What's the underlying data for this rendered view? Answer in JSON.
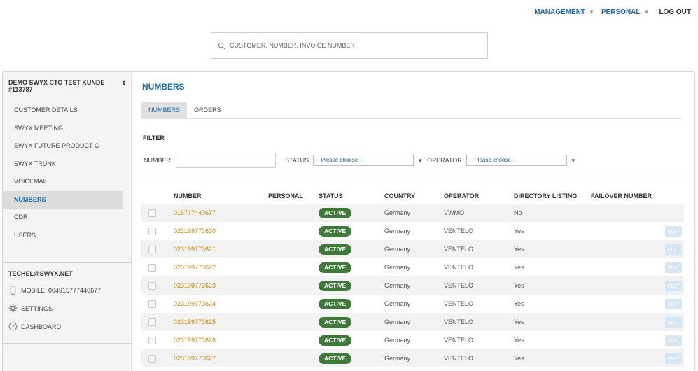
{
  "topnav": {
    "management": "MANAGEMENT",
    "personal": "PERSONAL",
    "logout": "LOG OUT"
  },
  "search": {
    "placeholder": "CUSTOMER, NUMBER, INVOICE NUMBER"
  },
  "sidebar": {
    "customer_title": "DEMO SWYX CTO TEST KUNDE #113787",
    "items": [
      {
        "label": "CUSTOMER DETAILS"
      },
      {
        "label": "SWYX MEETING"
      },
      {
        "label": "SWYX FUTURE PRODUCT C"
      },
      {
        "label": "SWYX TRUNK"
      },
      {
        "label": "VOICEMAIL"
      },
      {
        "label": "NUMBERS"
      },
      {
        "label": "CDR"
      },
      {
        "label": "USERS"
      }
    ],
    "active_item": "NUMBERS",
    "user_email": "TECHEL@SWYX.NET",
    "mobile": "MOBILE: 004915777440677",
    "settings": "SETTINGS",
    "dashboard": "DASHBOARD"
  },
  "main": {
    "title": "NUMBERS",
    "tabs": [
      {
        "label": "NUMBERS"
      },
      {
        "label": "ORDERS"
      }
    ],
    "filter": {
      "title": "FILTER",
      "number_label": "NUMBER",
      "status_label": "STATUS",
      "status_value": "-- Please choose --",
      "operator_label": "OPERATOR",
      "operator_value": "-- Please choose --"
    },
    "table": {
      "headers": [
        "NUMBER",
        "PERSONAL",
        "STATUS",
        "COUNTRY",
        "OPERATOR",
        "DIRECTORY LISTING",
        "FAILOVER NUMBER"
      ],
      "edit_label": "EDIT",
      "rows": [
        {
          "number": "015777440677",
          "personal": "",
          "status": "ACTIVE",
          "country": "Germany",
          "operator": "VWMO",
          "directory": "No",
          "failover": "",
          "edit": false
        },
        {
          "number": "023199773620",
          "personal": "",
          "status": "ACTIVE",
          "country": "Germany",
          "operator": "VENTELO",
          "directory": "Yes",
          "failover": "",
          "edit": true
        },
        {
          "number": "023199773621",
          "personal": "",
          "status": "ACTIVE",
          "country": "Germany",
          "operator": "VENTELO",
          "directory": "Yes",
          "failover": "",
          "edit": true
        },
        {
          "number": "023199773622",
          "personal": "",
          "status": "ACTIVE",
          "country": "Germany",
          "operator": "VENTELO",
          "directory": "Yes",
          "failover": "",
          "edit": true
        },
        {
          "number": "023199773623",
          "personal": "",
          "status": "ACTIVE",
          "country": "Germany",
          "operator": "VENTELO",
          "directory": "Yes",
          "failover": "",
          "edit": true
        },
        {
          "number": "023199773624",
          "personal": "",
          "status": "ACTIVE",
          "country": "Germany",
          "operator": "VENTELO",
          "directory": "Yes",
          "failover": "",
          "edit": true
        },
        {
          "number": "023199773625",
          "personal": "",
          "status": "ACTIVE",
          "country": "Germany",
          "operator": "VENTELO",
          "directory": "Yes",
          "failover": "",
          "edit": true
        },
        {
          "number": "023199773626",
          "personal": "",
          "status": "ACTIVE",
          "country": "Germany",
          "operator": "VENTELO",
          "directory": "Yes",
          "failover": "",
          "edit": true
        },
        {
          "number": "023199773627",
          "personal": "",
          "status": "ACTIVE",
          "country": "Germany",
          "operator": "VENTELO",
          "directory": "Yes",
          "failover": "",
          "edit": true
        }
      ]
    }
  },
  "colors": {
    "accent": "#1f6aa6",
    "number_link": "#c98b1b",
    "active_badge": "#3f7a3a",
    "edit_button": "#d5e6f5"
  },
  "icons": {
    "search": "search-icon",
    "collapse": "chevron-left-icon",
    "mobile": "mobile-phone-icon",
    "settings": "gear-icon",
    "dashboard": "dashboard-icon",
    "dropdown": "caret-down-icon"
  }
}
